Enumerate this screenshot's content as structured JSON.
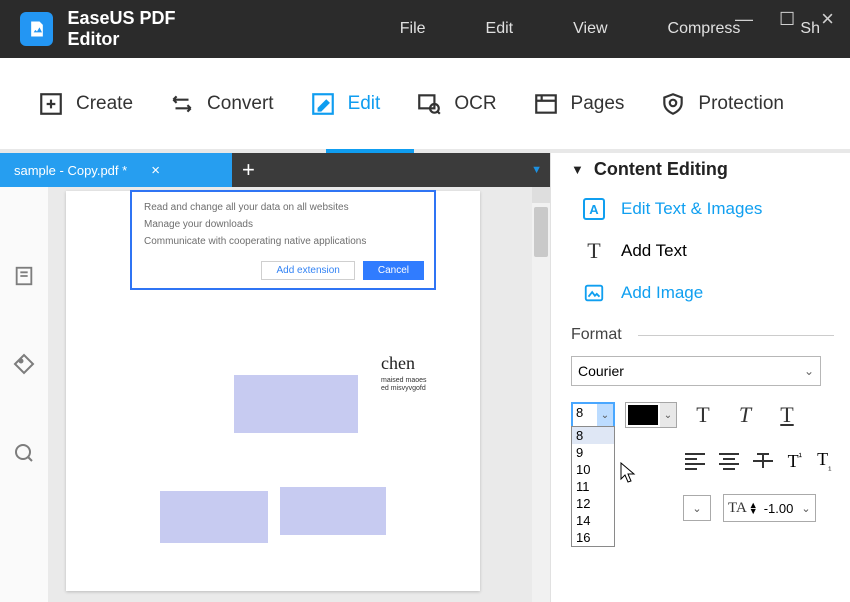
{
  "app": {
    "title": "EaseUS PDF Editor"
  },
  "menus": [
    "File",
    "Edit",
    "View",
    "Compress",
    "Sh"
  ],
  "ribbon": {
    "items": [
      {
        "label": "Create"
      },
      {
        "label": "Convert"
      },
      {
        "label": "Edit"
      },
      {
        "label": "OCR"
      },
      {
        "label": "Pages"
      },
      {
        "label": "Protection"
      }
    ],
    "active_index": 2
  },
  "tab": {
    "title": "sample - Copy.pdf *"
  },
  "dialog": {
    "line1": "Read and change all your data on all websites",
    "line2": "Manage your downloads",
    "line3": "Communicate with cooperating native applications",
    "add": "Add extension",
    "cancel": "Cancel"
  },
  "doc": {
    "chen": "chen",
    "chen_sub": "maised maoesed misvyvgofd"
  },
  "panel": {
    "title": "Content Editing",
    "items": [
      {
        "label": "Edit Text & Images"
      },
      {
        "label": "Add Text"
      },
      {
        "label": "Add Image"
      }
    ],
    "format_label": "Format",
    "font": "Courier",
    "size": "8",
    "size_options": [
      "8",
      "9",
      "10",
      "11",
      "12",
      "14",
      "16"
    ],
    "spacing": "-1.00"
  }
}
